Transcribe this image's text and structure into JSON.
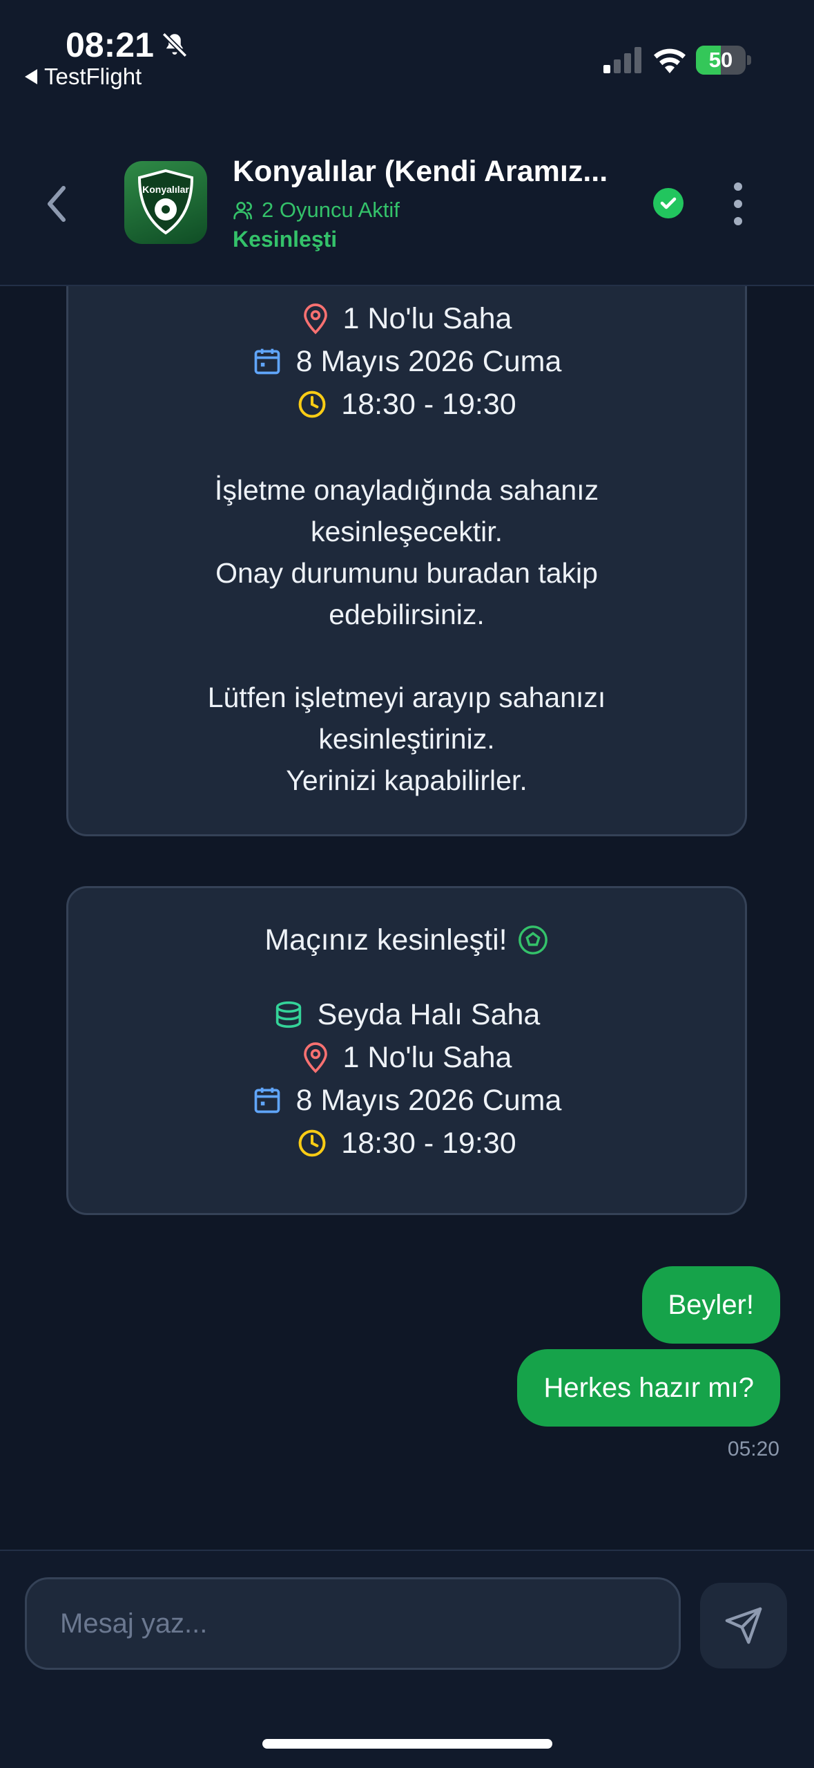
{
  "status_bar": {
    "time": "08:21",
    "back_app": "TestFlight",
    "battery": "50",
    "battery_level_percent": 50
  },
  "header": {
    "title": "Konyalılar (Kendi Aramız...",
    "players": "2 Oyuncu Aktif",
    "status": "Kesinleşti",
    "avatar_logo_text": "Konyalılar"
  },
  "card1": {
    "lines": {
      "pitch": "1 No'lu Saha",
      "date": "8 Mayıs 2026 Cuma",
      "time": "18:30 - 19:30"
    },
    "paragraphs": [
      "İşletme onayladığında sahanız",
      "kesinleşecektir.",
      "Onay durumunu buradan takip",
      "edebilirsiniz.",
      "Lütfen işletmeyi arayıp sahanızı",
      "kesinleştiriniz.",
      "Yerinizi kapabilirler."
    ]
  },
  "card2": {
    "title": "Maçınız kesinleşti!",
    "venue": "Seyda Halı Saha",
    "pitch": "1 No'lu Saha",
    "date": "8 Mayıs 2026 Cuma",
    "time": "18:30 - 19:30"
  },
  "messages": [
    {
      "text": "Beyler!"
    },
    {
      "text": "Herkes hazır mı?"
    }
  ],
  "message_time": "05:20",
  "input": {
    "placeholder": "Mesaj yaz..."
  },
  "colors": {
    "background": "#0f1726",
    "card": "#1e293b",
    "accent_green": "#16a34a",
    "status_green": "#34c26a",
    "pin_red": "#f87171",
    "calendar_blue": "#60a5fa",
    "clock_yellow": "#facc15"
  },
  "icons": {
    "silent": "bell-slash-icon",
    "signal": "cellular-signal-icon",
    "wifi": "wifi-icon",
    "battery": "battery-icon",
    "back": "chevron-left-icon",
    "players": "users-icon",
    "verified": "check-circle-icon",
    "menu": "dots-vertical-icon",
    "location": "map-pin-icon",
    "date": "calendar-icon",
    "time": "clock-icon",
    "venue": "database-icon",
    "ball": "soccer-ball-icon",
    "send": "send-icon"
  }
}
